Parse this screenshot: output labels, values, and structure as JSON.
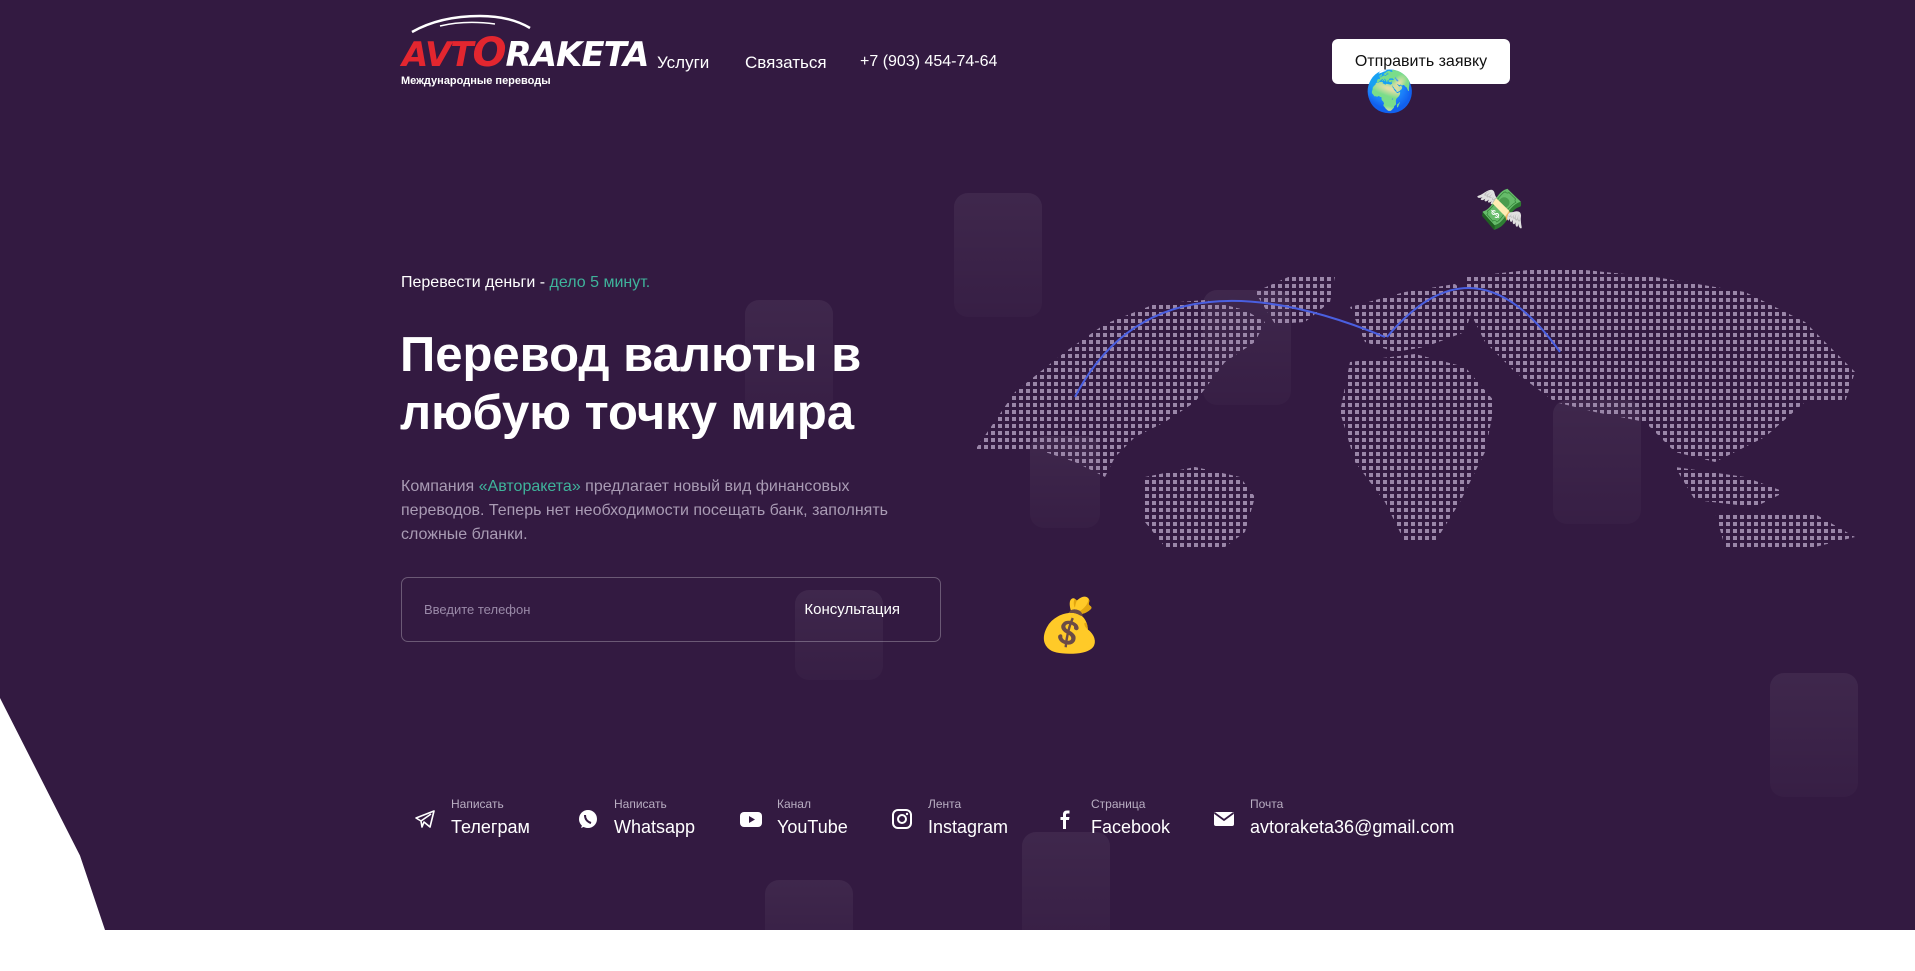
{
  "logo": {
    "brand_a": "AVT",
    "brand_o": "O",
    "brand_b": "RAKETA",
    "subtitle": "Международные переводы"
  },
  "nav": {
    "services": "Услуги",
    "contact": "Связаться",
    "phone": "+7 (903) 454-74-64"
  },
  "header": {
    "cta_label": "Отправить заявку"
  },
  "hero": {
    "tagline_prefix": "Перевести деньги - ",
    "tagline_accent": "дело 5 минут.",
    "headline": "Перевод валюты в любую точку мира",
    "desc_prefix": "Компания ",
    "desc_accent": "«Авторакета»",
    "desc_suffix": " предлагает новый вид финансовых переводов. Теперь нет необходимости посещать банк, заполнять сложные бланки.",
    "phone_placeholder": "Введите телефон",
    "consult_label": "Консультация"
  },
  "contacts": [
    {
      "icon": "telegram-icon",
      "small": "Написать",
      "big": "Телеграм"
    },
    {
      "icon": "whatsapp-icon",
      "small": "Написать",
      "big": "Whatsapp"
    },
    {
      "icon": "youtube-icon",
      "small": "Канал",
      "big": "YouTube"
    },
    {
      "icon": "instagram-icon",
      "small": "Лента",
      "big": "Instagram"
    },
    {
      "icon": "facebook-icon",
      "small": "Страница",
      "big": "Facebook"
    },
    {
      "icon": "mail-icon",
      "small": "Почта",
      "big": "avtoraketa36@gmail.com"
    }
  ],
  "colors": {
    "background": "#331a41",
    "accent": "#3fb39b",
    "brand_red": "#e3262f",
    "route_line": "#4a5fe0"
  }
}
